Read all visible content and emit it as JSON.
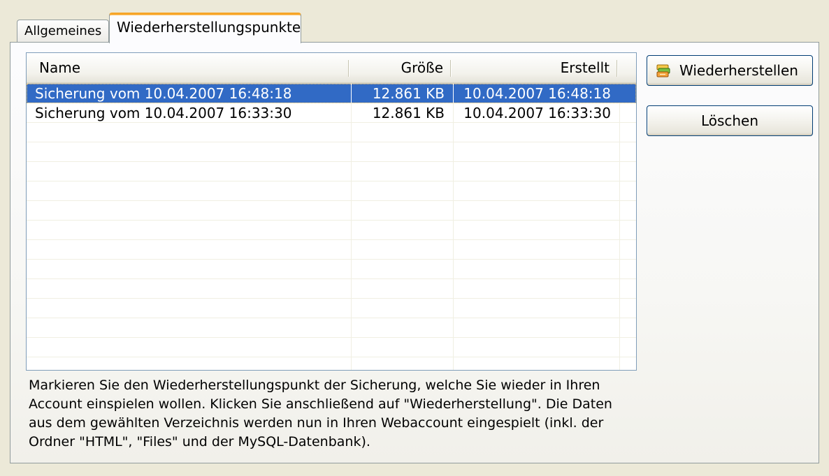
{
  "tabs": [
    {
      "label": "Allgemeines",
      "active": false
    },
    {
      "label": "Wiederherstellungspunkte",
      "active": true
    }
  ],
  "list": {
    "columns": {
      "name": "Name",
      "size": "Größe",
      "created": "Erstellt"
    },
    "rows": [
      {
        "name": "Sicherung vom 10.04.2007 16:48:18",
        "size": "12.861 KB",
        "created": "10.04.2007 16:48:18",
        "selected": true
      },
      {
        "name": "Sicherung vom 10.04.2007 16:33:30",
        "size": "12.861 KB",
        "created": "10.04.2007 16:33:30",
        "selected": false
      }
    ]
  },
  "buttons": {
    "restore_label": "Wiederherstellen",
    "restore_icon": "restore-icon",
    "delete_label": "Löschen"
  },
  "description": "Markieren Sie den Wiederherstellungspunkt der Sicherung, welche Sie wieder in Ihren Account einspielen wollen. Klicken Sie anschließend auf \"Wiederherstellung\". Die Daten aus dem gewählten Verzeichnis werden nun in Ihren Webaccount eingespielt (inkl. der Ordner \"HTML\", \"Files\" und der MySQL-Datenbank).",
  "colors": {
    "selection": "#316ac5",
    "active_tab_accent": "#f6a528",
    "background": "#ece9d8"
  }
}
